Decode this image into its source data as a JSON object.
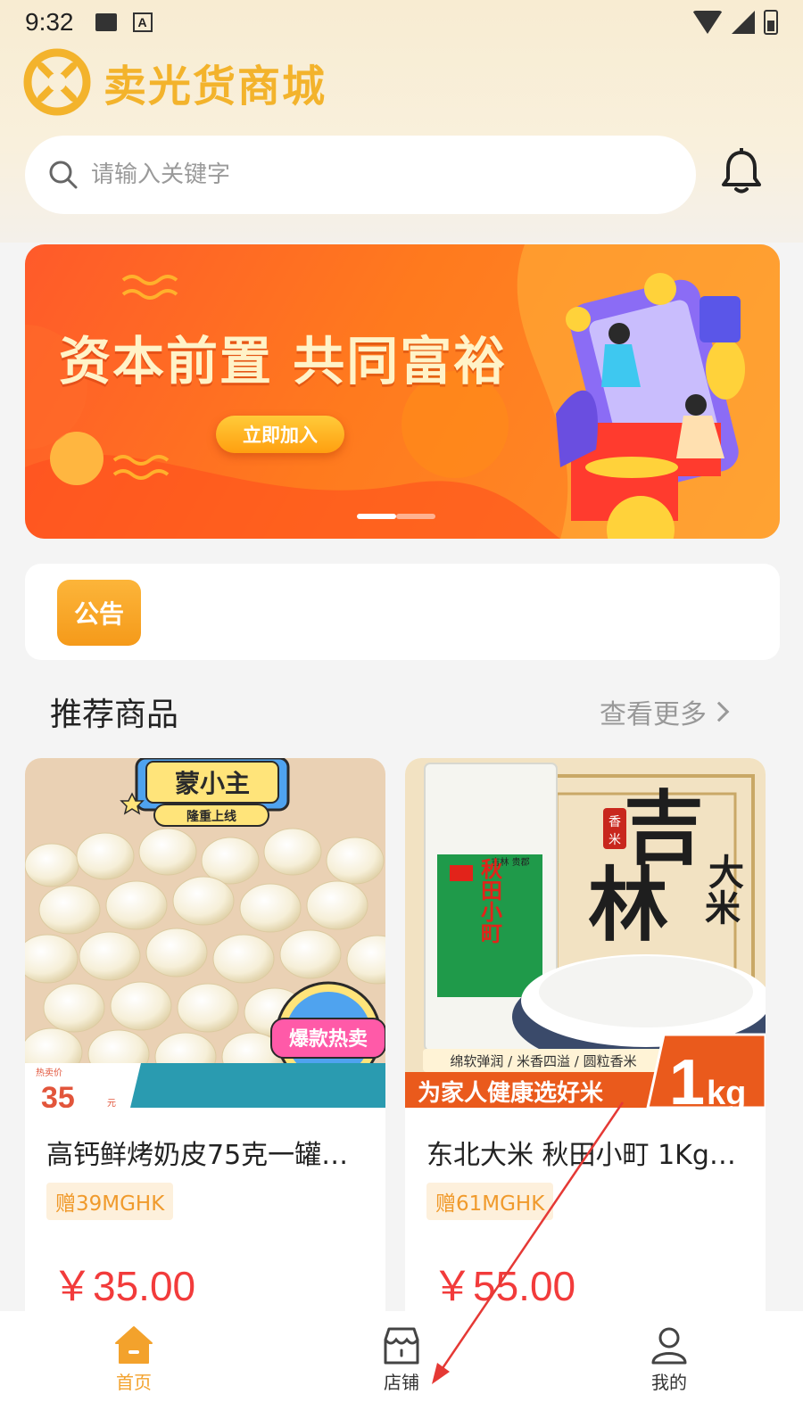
{
  "status_bar": {
    "time": "9:32"
  },
  "brand": {
    "name": "卖光货商城"
  },
  "search": {
    "placeholder": "请输入关键字"
  },
  "banner": {
    "title": "资本前置 共同富裕",
    "button_label": "立即加入",
    "page_count": 2,
    "active_page": 1
  },
  "notice": {
    "badge": "公告"
  },
  "recommend": {
    "title": "推荐商品",
    "more_label": "查看更多"
  },
  "products": [
    {
      "title": "高钙鲜烤奶皮75克一罐…",
      "tag": "赠39MGHK",
      "price": "￥35.00",
      "image": {
        "brand": "蒙小主",
        "slogan": "隆重上线",
        "badge": "爆款热卖",
        "price_label": "热卖价",
        "price_value": "35",
        "price_unit": "元"
      }
    },
    {
      "title": "东北大米 秋田小町 1Kg…",
      "tag": "赠61MGHK",
      "price": "￥55.00",
      "image": {
        "headline_1": "吉林",
        "headline_2": "大米",
        "seal": "香米",
        "bag_label": "秋田小町",
        "bag_brand": "吉林 贵郡",
        "feature_line": "绵软弹润 / 米香四溢 / 圆粒香米",
        "bottom_slogan": "为家人健康选好米",
        "weight_value": "1",
        "weight_unit": "kg"
      }
    }
  ],
  "tabbar": [
    {
      "label": "首页",
      "active": true
    },
    {
      "label": "店铺",
      "active": false
    },
    {
      "label": "我的",
      "active": false
    }
  ],
  "colors": {
    "accent": "#f3a22c",
    "price": "#f23b3b",
    "annotation_arrow": "#e53935"
  }
}
